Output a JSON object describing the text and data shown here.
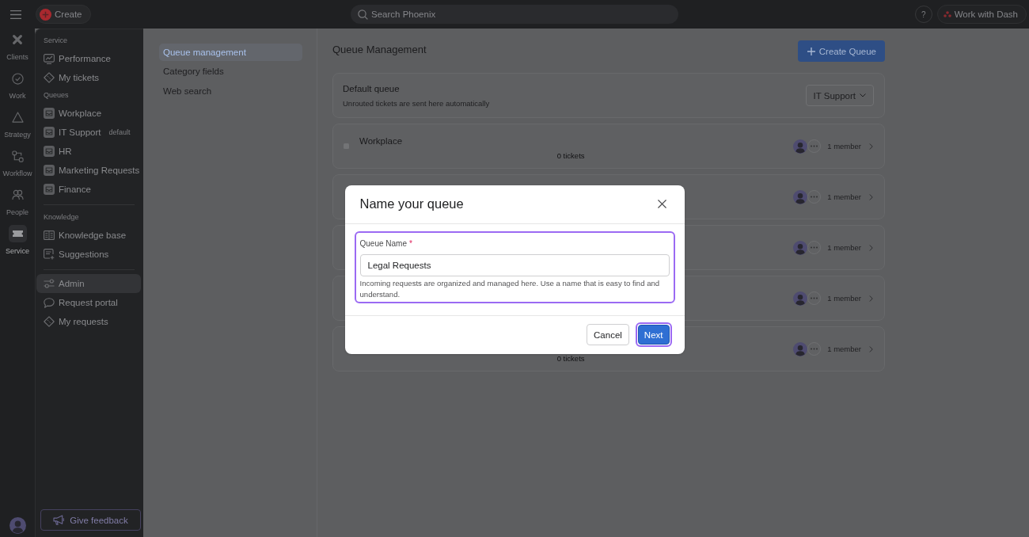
{
  "topbar": {
    "create_button": "Create",
    "search": {
      "placeholder": "Search Phoenix"
    },
    "help_button": "?",
    "dash_button": "Work with Dash"
  },
  "rail": [
    {
      "label": "Clients",
      "kind": "clients",
      "selected": false
    },
    {
      "label": "Work",
      "kind": "work",
      "selected": false
    },
    {
      "label": "Strategy",
      "kind": "strategy",
      "selected": false
    },
    {
      "label": "Workflow",
      "kind": "workflow",
      "selected": false
    },
    {
      "label": "People",
      "kind": "people",
      "selected": false
    },
    {
      "label": "Service",
      "kind": "service",
      "selected": true
    }
  ],
  "sidebar": {
    "sections": [
      {
        "heading": "Service",
        "divider_before": false,
        "items": [
          {
            "label": "Performance",
            "kind": "report",
            "selected": false
          },
          {
            "label": "My tickets",
            "kind": "ticket",
            "selected": false
          }
        ]
      },
      {
        "heading": "Queues",
        "divider_before": false,
        "items": [
          {
            "label": "Workplace",
            "kind": "queue",
            "selected": false
          },
          {
            "label": "IT Support",
            "kind": "queue",
            "badge": "default",
            "selected": false
          },
          {
            "label": "HR",
            "kind": "queue",
            "selected": false
          },
          {
            "label": "Marketing Requests",
            "kind": "queue",
            "selected": false
          },
          {
            "label": "Finance",
            "kind": "queue",
            "selected": false
          }
        ]
      },
      {
        "heading": "Knowledge",
        "divider_before": true,
        "items": [
          {
            "label": "Knowledge base",
            "kind": "book",
            "selected": false
          },
          {
            "label": "Suggestions",
            "kind": "suggestion",
            "selected": false
          }
        ]
      },
      {
        "divider_before": true,
        "items": [
          {
            "label": "Admin",
            "kind": "admin",
            "selected": true
          },
          {
            "label": "Request portal",
            "kind": "portal",
            "selected": false
          },
          {
            "label": "My requests",
            "kind": "ticket",
            "selected": false
          }
        ]
      }
    ],
    "feedback_button": "Give feedback"
  },
  "settings_nav": [
    {
      "label": "Queue management",
      "selected": true
    },
    {
      "label": "Category fields",
      "selected": false
    },
    {
      "label": "Web search",
      "selected": false
    }
  ],
  "main": {
    "title": "Queue Management",
    "create_button": "Create Queue",
    "default_queue": {
      "title": "Default queue",
      "description": "Unrouted tickets are sent here automatically",
      "value": "IT Support"
    },
    "queues": [
      {
        "name": "Workplace",
        "tickets": "0 tickets",
        "members": "1 member"
      },
      {
        "members": "1 member"
      },
      {
        "members": "1 member"
      },
      {
        "members": "1 member"
      },
      {
        "tickets": "0 tickets",
        "members": "1 member"
      }
    ]
  },
  "dialog": {
    "title": "Name your queue",
    "field": {
      "label": "Queue Name",
      "required_mark": "*",
      "value": "Legal Requests",
      "help": "Incoming requests are organized and managed here. Use a name that is easy to find and understand.",
      "focused": true
    },
    "buttons": [
      {
        "label": "Cancel",
        "kind": "secondary",
        "focused": false
      },
      {
        "label": "Next",
        "kind": "primary",
        "focused": true
      }
    ]
  }
}
